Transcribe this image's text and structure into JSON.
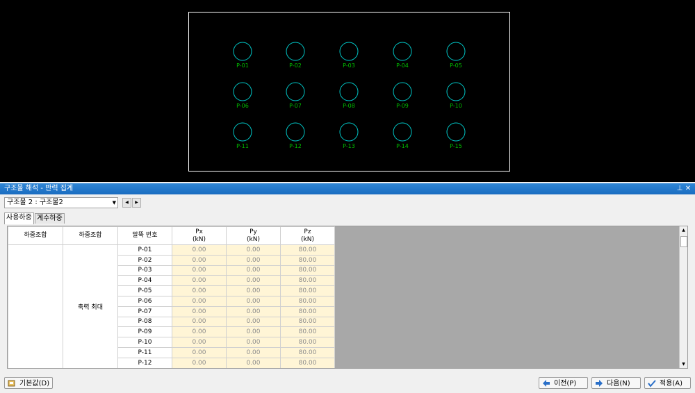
{
  "cad": {
    "piles_row1": [
      "P-01",
      "P-02",
      "P-03",
      "P-04",
      "P-05"
    ],
    "piles_row2": [
      "P-06",
      "P-07",
      "P-08",
      "P-09",
      "P-10"
    ],
    "piles_row3": [
      "P-11",
      "P-12",
      "P-13",
      "P-14",
      "P-15"
    ],
    "colors": {
      "circle": "#00c8c8",
      "label": "#00c000",
      "outline": "#ffffff"
    }
  },
  "panel": {
    "title": "구조물 해석 - 반력 집계",
    "pin_icon": "pin-icon",
    "close_icon": "close-icon",
    "structure_select": "구조물 2 : 구조물2",
    "tabs": [
      "사용하중",
      "계수하중"
    ],
    "columns": [
      "하중조합",
      "하중조합",
      "말뚝 번호",
      "Px\n(kN)",
      "Py\n(kN)",
      "Pz\n(kN)"
    ],
    "load_case": "축력 최대",
    "rows": [
      {
        "pile": "P-01",
        "px": "0.00",
        "py": "0.00",
        "pz": "80.00"
      },
      {
        "pile": "P-02",
        "px": "0.00",
        "py": "0.00",
        "pz": "80.00"
      },
      {
        "pile": "P-03",
        "px": "0.00",
        "py": "0.00",
        "pz": "80.00"
      },
      {
        "pile": "P-04",
        "px": "0.00",
        "py": "0.00",
        "pz": "80.00"
      },
      {
        "pile": "P-05",
        "px": "0.00",
        "py": "0.00",
        "pz": "80.00"
      },
      {
        "pile": "P-06",
        "px": "0.00",
        "py": "0.00",
        "pz": "80.00"
      },
      {
        "pile": "P-07",
        "px": "0.00",
        "py": "0.00",
        "pz": "80.00"
      },
      {
        "pile": "P-08",
        "px": "0.00",
        "py": "0.00",
        "pz": "80.00"
      },
      {
        "pile": "P-09",
        "px": "0.00",
        "py": "0.00",
        "pz": "80.00"
      },
      {
        "pile": "P-10",
        "px": "0.00",
        "py": "0.00",
        "pz": "80.00"
      },
      {
        "pile": "P-11",
        "px": "0.00",
        "py": "0.00",
        "pz": "80.00"
      },
      {
        "pile": "P-12",
        "px": "0.00",
        "py": "0.00",
        "pz": "80.00"
      }
    ]
  },
  "buttons": {
    "default": "기본값(D)",
    "prev": "이전(P)",
    "next": "다음(N)",
    "apply": "적용(A)"
  }
}
